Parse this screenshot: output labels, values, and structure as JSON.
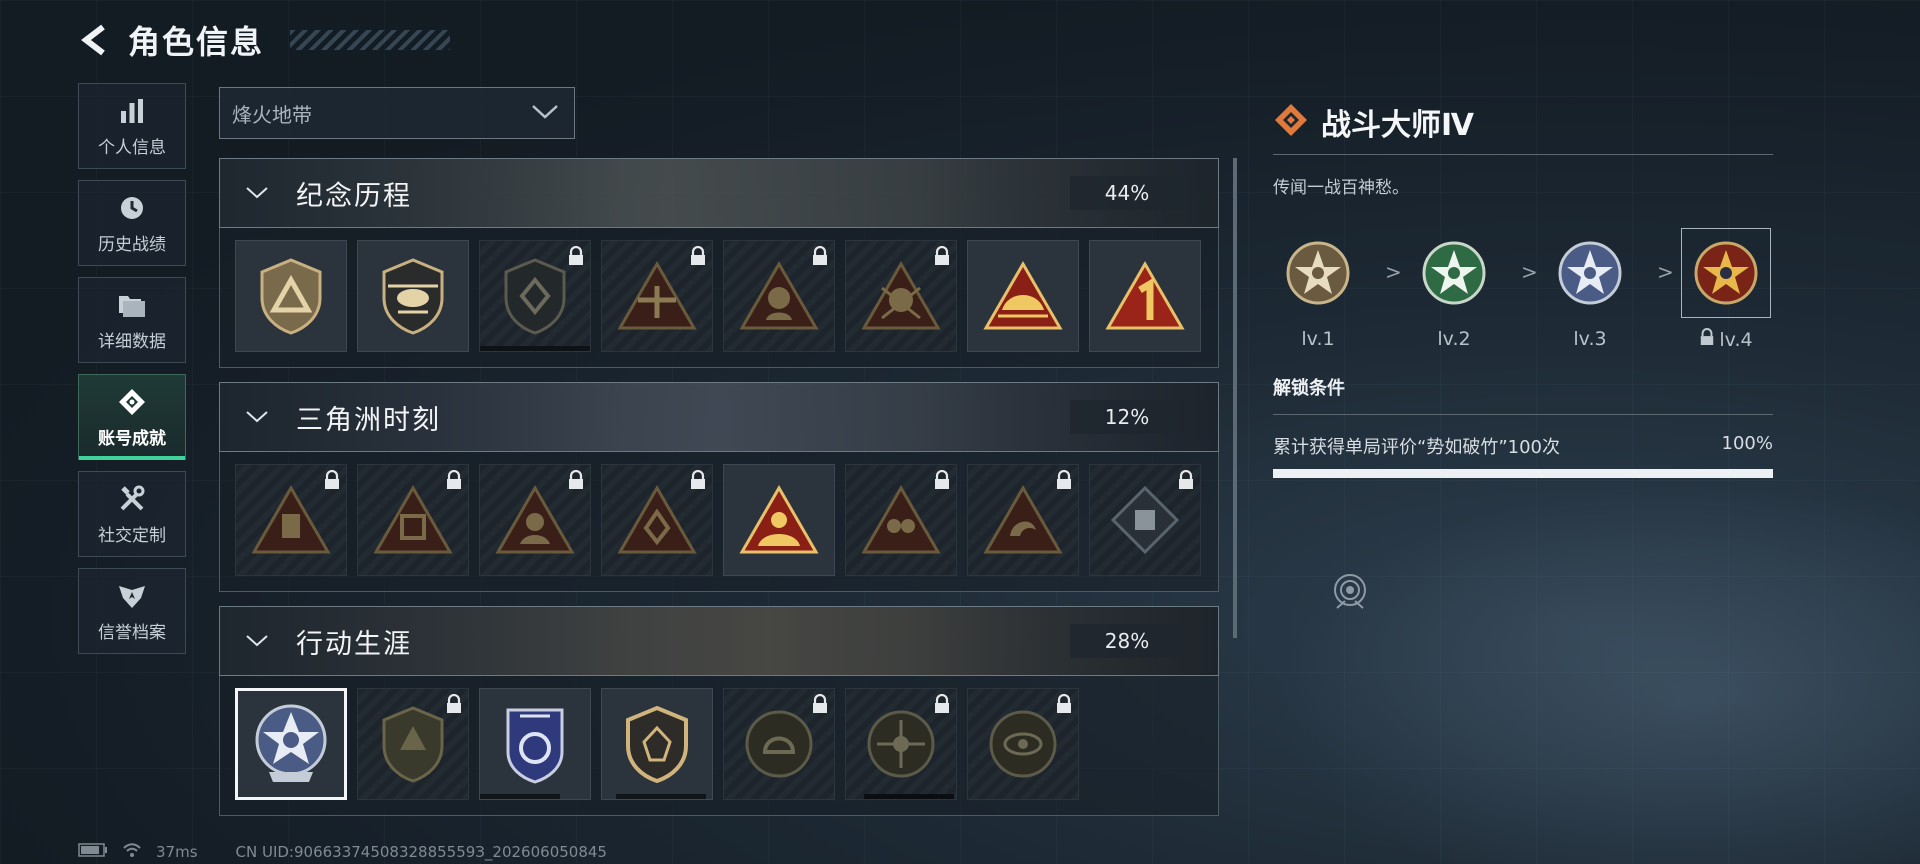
{
  "header": {
    "title": "角色信息"
  },
  "sidebar": {
    "items": [
      {
        "label": "个人信息",
        "icon": "bar-chart-icon"
      },
      {
        "label": "历史战绩",
        "icon": "clock-icon"
      },
      {
        "label": "详细数据",
        "icon": "folder-icon"
      },
      {
        "label": "账号成就",
        "icon": "achievement-icon",
        "active": true
      },
      {
        "label": "社交定制",
        "icon": "tools-icon"
      },
      {
        "label": "信誉档案",
        "icon": "shield-wing-icon"
      }
    ]
  },
  "mode_select": {
    "value": "烽火地带"
  },
  "sections": [
    {
      "title": "纪念历程",
      "percent": "44%"
    },
    {
      "title": "三角洲时刻",
      "percent": "12%"
    },
    {
      "title": "行动生涯",
      "percent": "28%"
    }
  ],
  "detail": {
    "title": "战斗大师Ⅳ",
    "description": "传闻一战百神愁。",
    "levels": [
      {
        "label": "lv.1"
      },
      {
        "label": "lv.2"
      },
      {
        "label": "lv.3"
      },
      {
        "label": "lv.4",
        "locked": true
      }
    ],
    "arrow": ">",
    "unlock_title": "解锁条件",
    "condition": {
      "text": "累计获得单局评价“势如破竹”100次",
      "percent": "100%",
      "progress": 1.0
    }
  },
  "footer": {
    "ping": "37ms",
    "uid": "CN UID:9066337450832885559З_202606050845"
  },
  "colors": {
    "accent_green": "#3ed39a",
    "title_icon_orange": "#e07a3c"
  }
}
